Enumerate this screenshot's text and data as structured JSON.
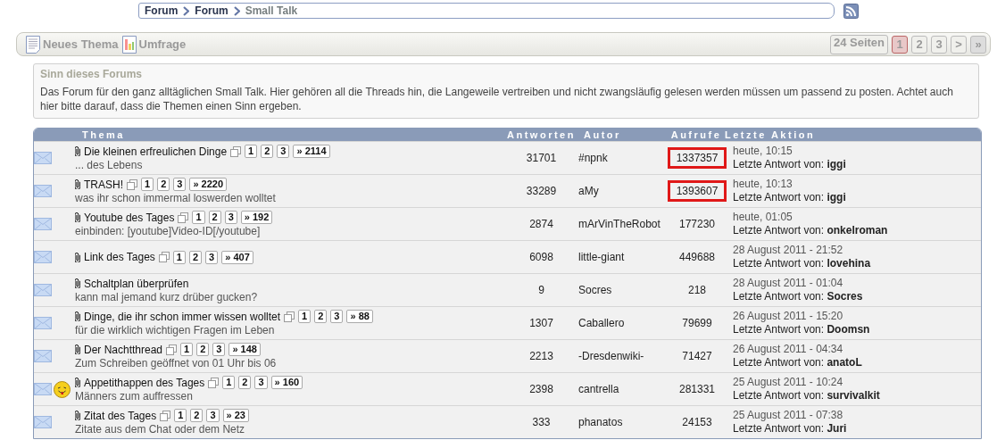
{
  "breadcrumb": [
    "Forum",
    "Forum",
    "Small Talk"
  ],
  "toolbar": {
    "actions": [
      {
        "kind": "new-topic",
        "label": "Neues Thema"
      },
      {
        "kind": "poll",
        "label": "Umfrage"
      }
    ],
    "pagination": {
      "summary": "24 Seiten",
      "pages": [
        {
          "label": "1",
          "selected": true
        },
        {
          "label": "2",
          "selected": false
        },
        {
          "label": "3",
          "selected": false
        }
      ],
      "next": ">",
      "last": "»"
    }
  },
  "info": {
    "title": "Sinn dieses Forums",
    "text": "Das Forum für den ganz alltäglichen Small Talk. Hier gehören all die Threads hin, die Langeweile vertreiben und nicht zwangsläufig gelesen werden müssen um passend zu posten. Achtet auch hier bitte darauf, dass die Themen einen Sinn ergeben."
  },
  "table": {
    "columns": [
      "Thema",
      "Antworten",
      "Autor",
      "Aufrufe",
      "Letzte Aktion"
    ],
    "rows": [
      {
        "title": "Die kleinen erfreulichen Dinge",
        "subtitle": "... des Lebens",
        "pages": [
          "1",
          "2",
          "3",
          "» 2114"
        ],
        "replies": "31701",
        "author": "#npnk",
        "views": "1337357",
        "views_highlighted": true,
        "emoji": false,
        "date": "heute, 10:15",
        "last_label": "Letzte Antwort von:",
        "last_user": "iggi"
      },
      {
        "title": "TRASH!",
        "subtitle": "was ihr schon immermal loswerden wolltet",
        "pages": [
          "1",
          "2",
          "3",
          "» 2220"
        ],
        "replies": "33289",
        "author": "aMy",
        "views": "1393607",
        "views_highlighted": true,
        "emoji": false,
        "date": "heute, 10:13",
        "last_label": "Letzte Antwort von:",
        "last_user": "iggi"
      },
      {
        "title": "Youtube des Tages",
        "subtitle": "einbinden: [youtube]Video-ID[/youtube]",
        "pages": [
          "1",
          "2",
          "3",
          "» 192"
        ],
        "replies": "2874",
        "author": "mArVinTheRobot",
        "views": "177230",
        "views_highlighted": false,
        "emoji": false,
        "date": "heute, 01:05",
        "last_label": "Letzte Antwort von:",
        "last_user": "onkelroman"
      },
      {
        "title": "Link des Tages",
        "pages": [
          "1",
          "2",
          "3",
          "» 407"
        ],
        "replies": "6098",
        "author": "little-giant",
        "views": "449688",
        "views_highlighted": false,
        "emoji": false,
        "date": "28 August 2011 - 21:52",
        "last_label": "Letzte Antwort von:",
        "last_user": "lovehina"
      },
      {
        "title": "Schaltplan überprüfen",
        "subtitle": "kann mal jemand kurz drüber gucken?",
        "replies": "9",
        "author": "Socres",
        "views": "218",
        "views_highlighted": false,
        "emoji": false,
        "date": "28 August 2011 - 01:04",
        "last_label": "Letzte Antwort von:",
        "last_user": "Socres"
      },
      {
        "title": "Dinge, die ihr schon immer wissen wolltet",
        "subtitle": "für die wirklich wichtigen Fragen im Leben",
        "pages": [
          "1",
          "2",
          "3",
          "» 88"
        ],
        "replies": "1307",
        "author": "Caballero",
        "views": "79699",
        "views_highlighted": false,
        "emoji": false,
        "date": "26 August 2011 - 15:20",
        "last_label": "Letzte Antwort von:",
        "last_user": "Doomsn"
      },
      {
        "title": "Der Nachtthread",
        "subtitle": "Zum Schreiben geöffnet von 01 Uhr bis 06",
        "pages": [
          "1",
          "2",
          "3",
          "» 148"
        ],
        "replies": "2213",
        "author": "-Dresdenwiki-",
        "views": "71427",
        "views_highlighted": false,
        "emoji": false,
        "date": "26 August 2011 - 04:34",
        "last_label": "Letzte Antwort von:",
        "last_user": "anatoL"
      },
      {
        "title": "Appetithappen des Tages",
        "subtitle": "Männers zum auffressen",
        "pages": [
          "1",
          "2",
          "3",
          "» 160"
        ],
        "replies": "2398",
        "author": "cantrella",
        "views": "281331",
        "views_highlighted": false,
        "emoji": true,
        "date": "25 August 2011 - 10:24",
        "last_label": "Letzte Antwort von:",
        "last_user": "survivalkit"
      },
      {
        "title": "Zitat des Tages",
        "subtitle": "Zitate aus dem Chat oder dem Netz",
        "pages": [
          "1",
          "2",
          "3",
          "» 23"
        ],
        "replies": "333",
        "author": "phanatos",
        "views": "24153",
        "views_highlighted": false,
        "emoji": false,
        "date": "25 August 2011 - 07:38",
        "last_label": "Letzte Antwort von:",
        "last_user": "Juri"
      }
    ]
  }
}
